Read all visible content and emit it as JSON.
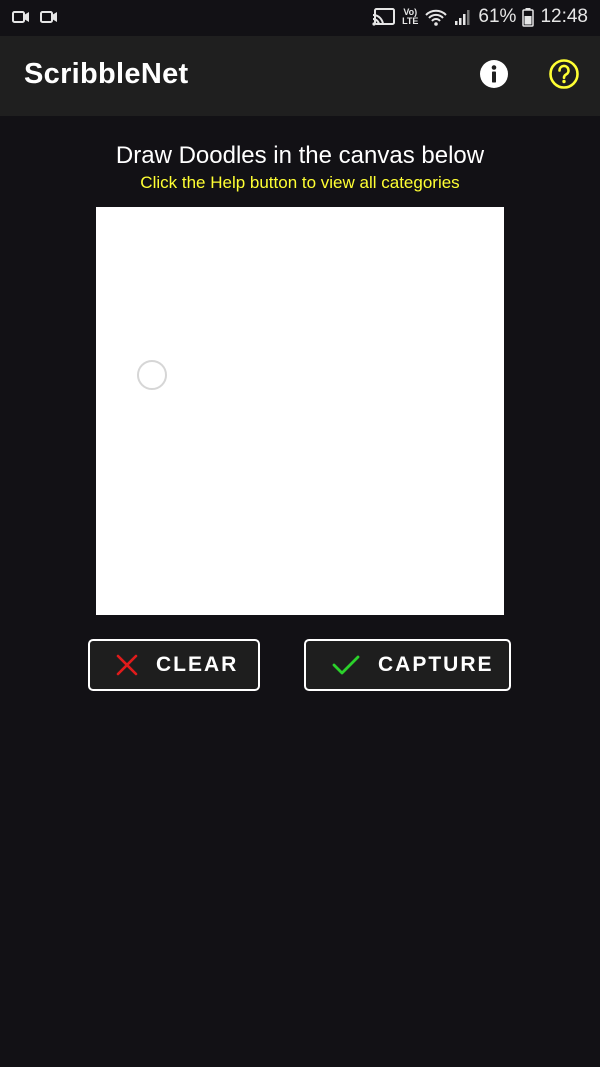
{
  "status_bar": {
    "battery": "61%",
    "time": "12:48",
    "lte_top": "Vo)",
    "lte_bottom": "LTE"
  },
  "app_bar": {
    "title": "ScribbleNet"
  },
  "main": {
    "heading": "Draw Doodles in the canvas below",
    "subheading": "Click the Help button to view all categories"
  },
  "buttons": {
    "clear_label": "CLEAR",
    "capture_label": "CAPTURE"
  },
  "colors": {
    "background": "#121115",
    "app_bar": "#1f1f1f",
    "accent_yellow": "#ffff33",
    "clear_icon": "#e01b1b",
    "capture_icon": "#2bd12b"
  },
  "icons": {
    "info": "info-icon",
    "help": "help-icon",
    "clear": "x-icon",
    "capture": "checkmark-icon"
  }
}
